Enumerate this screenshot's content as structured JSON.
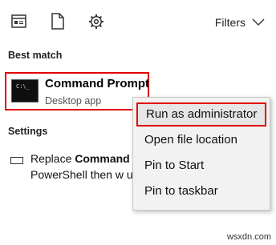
{
  "toolbar": {
    "icons": [
      "apps-icon",
      "documents-icon",
      "settings-gear-icon"
    ],
    "filters_label": "Filters"
  },
  "best_match": {
    "heading": "Best match",
    "title": "Command Prompt",
    "subtitle": "Desktop app",
    "icon_text": "C:\\_",
    "highlight_color": "#e00000"
  },
  "settings": {
    "heading": "Settings",
    "item": {
      "line1_prefix": "Replace ",
      "line1_bold": "Command",
      "line2": "PowerShell then w u"
    }
  },
  "context_menu": {
    "items": [
      {
        "label": "Run as administrator",
        "highlighted": true
      },
      {
        "label": "Open file location",
        "highlighted": false
      },
      {
        "label": "Pin to Start",
        "highlighted": false
      },
      {
        "label": "Pin to taskbar",
        "highlighted": false
      }
    ]
  },
  "watermark": "wsxdn.com"
}
